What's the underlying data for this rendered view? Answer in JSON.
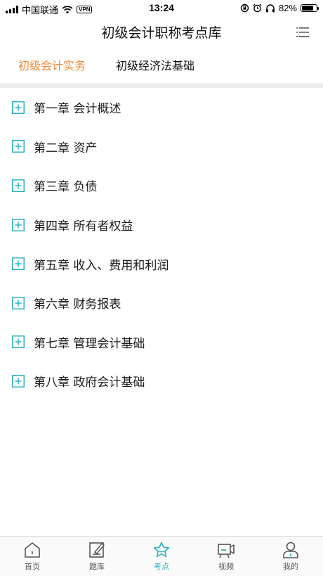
{
  "status_bar": {
    "carrier": "中国联通",
    "vpn": "VPN",
    "time": "13:24",
    "battery": "82%",
    "battery_level": 0.82
  },
  "header": {
    "title": "初级会计职称考点库"
  },
  "tabs": [
    {
      "label": "初级会计实务",
      "active": true
    },
    {
      "label": "初级经济法基础",
      "active": false
    }
  ],
  "chapters": [
    {
      "label": "第一章 会计概述"
    },
    {
      "label": "第二章 资产"
    },
    {
      "label": "第三章 负债"
    },
    {
      "label": "第四章 所有者权益"
    },
    {
      "label": "第五章 收入、费用和利润"
    },
    {
      "label": "第六章 财务报表"
    },
    {
      "label": "第七章 管理会计基础"
    },
    {
      "label": "第八章 政府会计基础"
    }
  ],
  "tabbar": [
    {
      "label": "首页",
      "icon": "home-icon",
      "active": false
    },
    {
      "label": "题库",
      "icon": "edit-icon",
      "active": false
    },
    {
      "label": "考点",
      "icon": "star-icon",
      "active": true
    },
    {
      "label": "视频",
      "icon": "video-icon",
      "active": false
    },
    {
      "label": "我的",
      "icon": "user-icon",
      "active": false
    }
  ],
  "colors": {
    "accent_tab": "#ef8a3a",
    "accent_teal": "#2bb3c0",
    "divider": "#eeeeee"
  }
}
